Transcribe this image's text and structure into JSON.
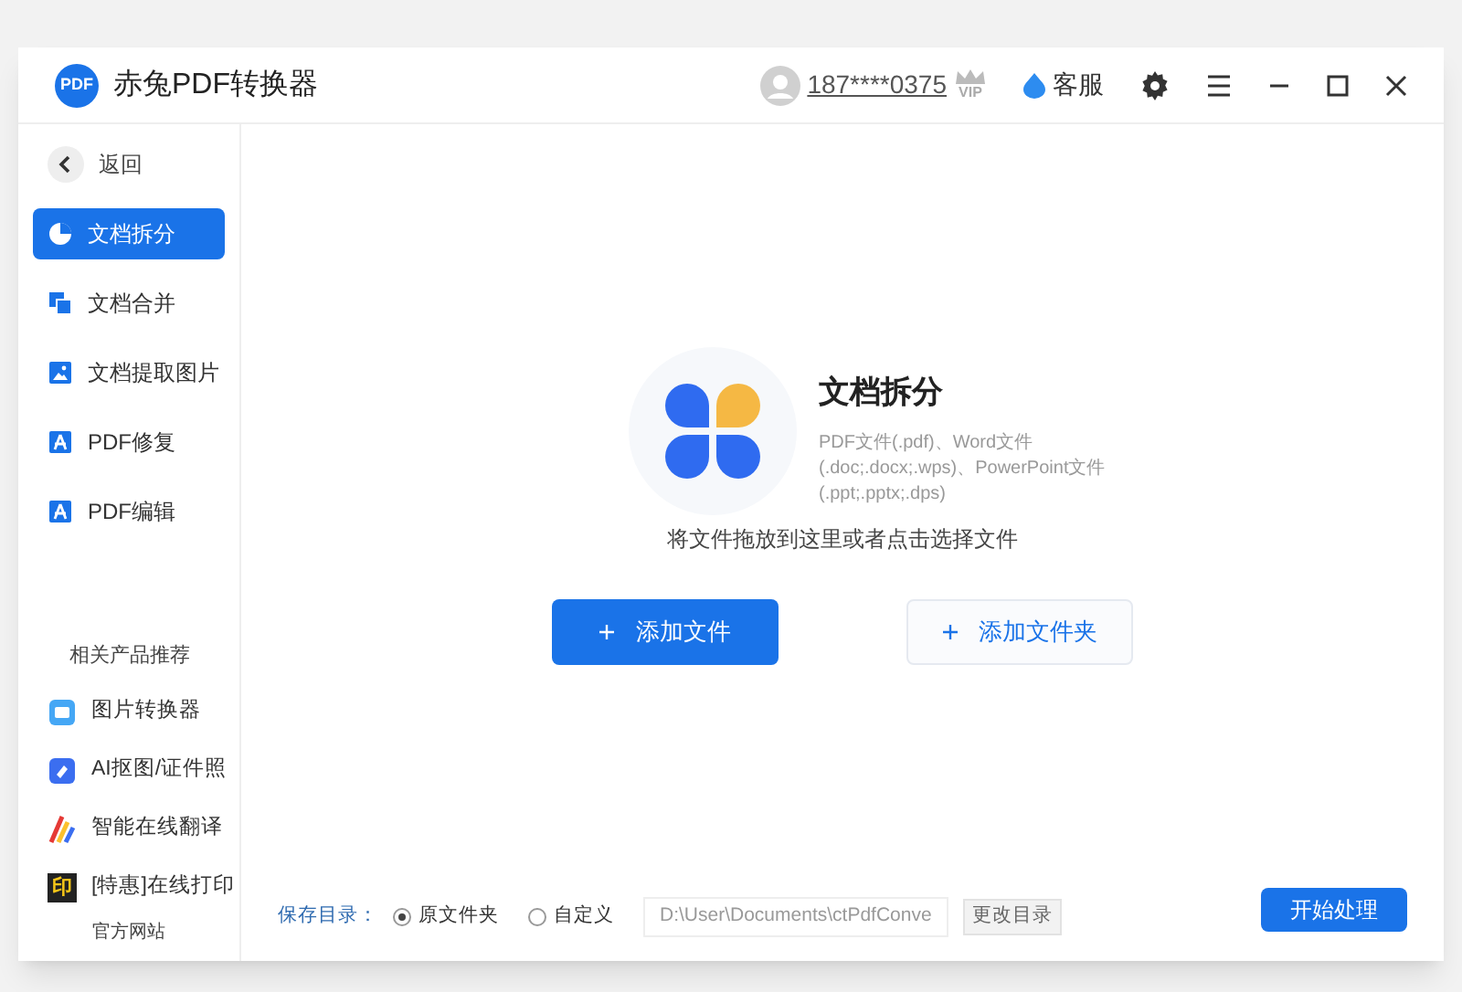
{
  "app": {
    "logo_text": "PDF",
    "title": "赤兔PDF转换器"
  },
  "header": {
    "user": "187****0375",
    "vip": "VIP",
    "service": "客服"
  },
  "sidebar": {
    "back": "返回",
    "items": [
      {
        "label": "文档拆分",
        "kind": "split",
        "selected": true
      },
      {
        "label": "文档合并",
        "kind": "merge",
        "selected": false
      },
      {
        "label": "文档提取图片",
        "kind": "image",
        "selected": false
      },
      {
        "label": "PDF修复",
        "kind": "pdf",
        "selected": false
      },
      {
        "label": "PDF编辑",
        "kind": "pdf",
        "selected": false
      }
    ],
    "recommend_title": "相关产品推荐",
    "products": [
      {
        "label": "图片转换器",
        "kind": "picture"
      },
      {
        "label": "AI抠图/证件照",
        "kind": "eraser"
      },
      {
        "label": "智能在线翻译",
        "kind": "brush"
      },
      {
        "label": "[特惠]在线打印",
        "kind": "print",
        "icon_text": "印"
      }
    ],
    "website": "官方网站"
  },
  "main": {
    "title": "文档拆分",
    "formats": "PDF文件(.pdf)、Word文件(.doc;.docx;.wps)、PowerPoint文件(.ppt;.pptx;.dps)",
    "hint": "将文件拖放到这里或者点击选择文件",
    "buttons": [
      {
        "label": "添加文件",
        "kind": "primary"
      },
      {
        "label": "添加文件夹",
        "kind": "secondary"
      }
    ]
  },
  "footer": {
    "save_label": "保存目录：",
    "options": [
      {
        "label": "原文件夹",
        "selected": true
      },
      {
        "label": "自定义",
        "selected": false
      }
    ],
    "path": "D:\\User\\Documents\\ctPdfConve",
    "change": "更改目录",
    "start": "开始处理"
  }
}
